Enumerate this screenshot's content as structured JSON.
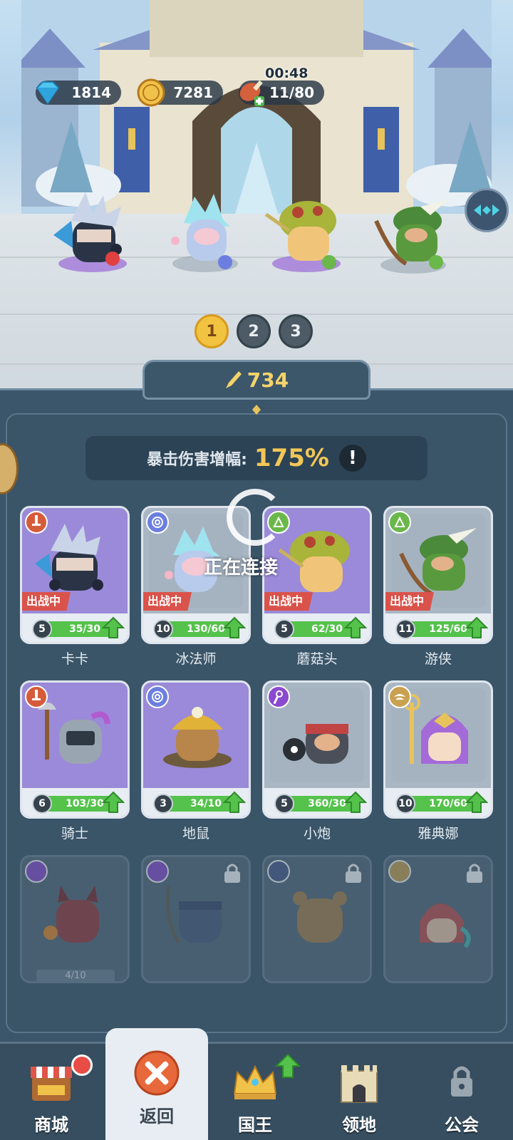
{
  "resources": {
    "gems": "1814",
    "coins": "7281",
    "stamina": "11/80",
    "stamina_timer": "00:48"
  },
  "formation": {
    "pages": [
      "1",
      "2",
      "3"
    ],
    "active_page": "1"
  },
  "power": "734",
  "crit_bonus": {
    "label": "暴击伤害增幅:",
    "value": "175%",
    "info": "!"
  },
  "connecting_text": "正在连接",
  "battle_tag": "出战中",
  "heroes": [
    {
      "name": "卡卡",
      "level": "5",
      "progress": "35/30",
      "fill": 1.0,
      "in_battle": true,
      "element": "sword"
    },
    {
      "name": "冰法师",
      "level": "10",
      "progress": "130/60",
      "fill": 1.0,
      "in_battle": true,
      "element": "spiral"
    },
    {
      "name": "蘑菇头",
      "level": "5",
      "progress": "62/30",
      "fill": 1.0,
      "in_battle": true,
      "element": "nature"
    },
    {
      "name": "游侠",
      "level": "11",
      "progress": "125/60",
      "fill": 1.0,
      "in_battle": true,
      "element": "nature"
    },
    {
      "name": "骑士",
      "level": "6",
      "progress": "103/30",
      "fill": 1.0,
      "in_battle": false,
      "element": "sword"
    },
    {
      "name": "地鼠",
      "level": "3",
      "progress": "34/10",
      "fill": 1.0,
      "in_battle": false,
      "element": "spiral"
    },
    {
      "name": "小炮",
      "level": "5",
      "progress": "360/30",
      "fill": 1.0,
      "in_battle": false,
      "element": "staff"
    },
    {
      "name": "雅典娜",
      "level": "10",
      "progress": "170/60",
      "fill": 1.0,
      "in_battle": false,
      "element": "wing"
    }
  ],
  "locked_heroes": [
    {
      "element": "staff",
      "progress": "4/10"
    },
    {
      "element": "eye"
    },
    {
      "element": "paw"
    },
    {
      "element": "wing"
    }
  ],
  "nav": [
    {
      "label": "商城",
      "icon": "shop-icon"
    },
    {
      "label": "返回",
      "icon": "close-icon"
    },
    {
      "label": "国王",
      "icon": "crown-icon"
    },
    {
      "label": "领地",
      "icon": "castle-icon"
    },
    {
      "label": "公会",
      "icon": "lock-icon"
    }
  ]
}
